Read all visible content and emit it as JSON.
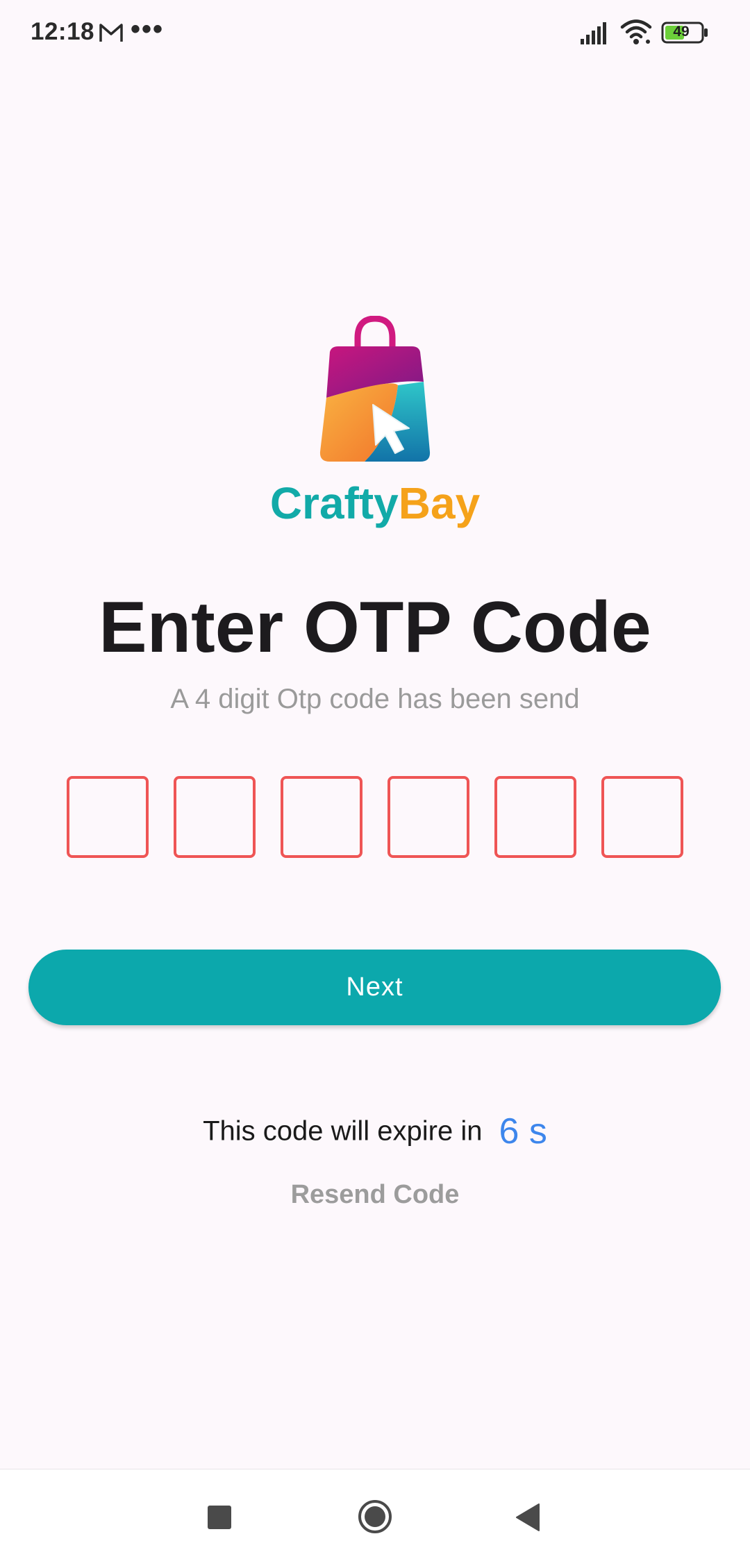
{
  "status_bar": {
    "time": "12:18",
    "dots": "•••",
    "battery": "49"
  },
  "logo": {
    "name_part1": "Crafty",
    "name_part2": "Bay"
  },
  "title": "Enter OTP Code",
  "subtitle": "A 4 digit Otp code has been send",
  "otp": {
    "digits": [
      "",
      "",
      "",
      "",
      "",
      ""
    ]
  },
  "next_button": "Next",
  "expire": {
    "label": "This code will expire in",
    "seconds": "6 s"
  },
  "resend": "Resend Code",
  "colors": {
    "accent": "#0ca8ac",
    "otp_border": "#ef5555",
    "countdown": "#3d86ec",
    "logo_crafty": "#12aaa8",
    "logo_bay": "#f5a21a"
  },
  "icons": {
    "status": [
      "gmail-icon",
      "signal-icon",
      "wifi-icon",
      "battery-icon"
    ],
    "nav": [
      "recent-apps-icon",
      "home-icon",
      "back-icon"
    ]
  }
}
